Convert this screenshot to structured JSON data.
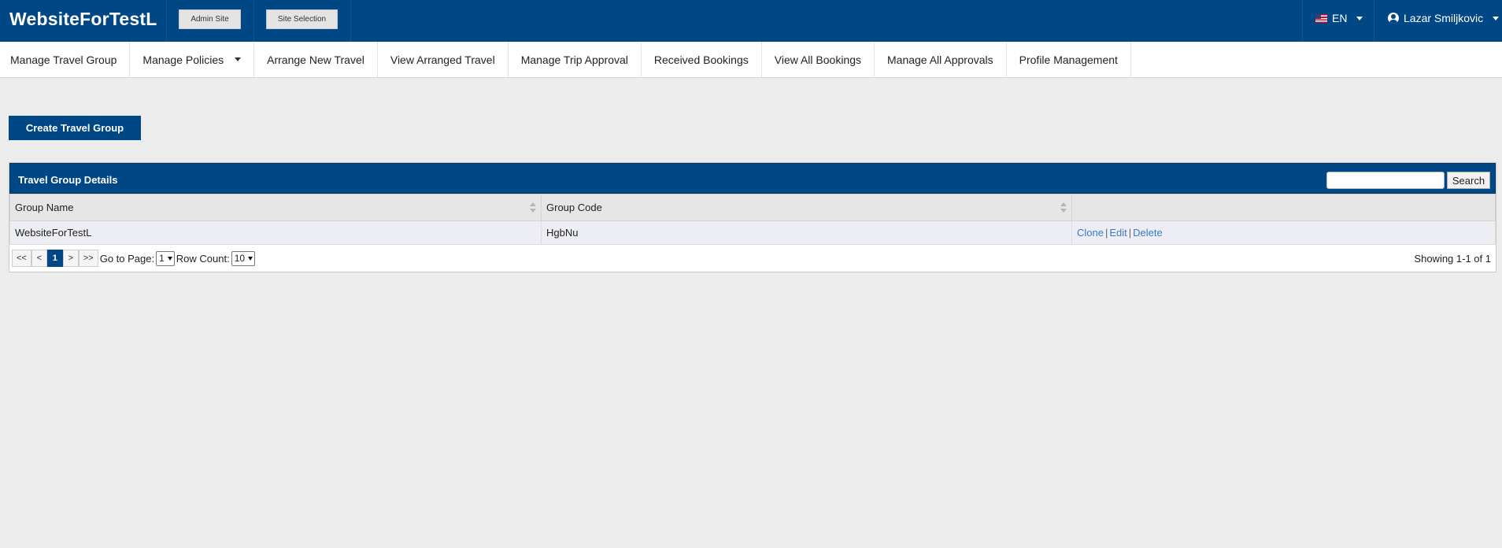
{
  "header": {
    "brand": "WebsiteForTestL",
    "admin_site": "Admin Site",
    "site_selection": "Site Selection",
    "language": "EN",
    "user_name": "Lazar Smiljkovic"
  },
  "nav": {
    "items": [
      {
        "label": "Manage Travel Group"
      },
      {
        "label": "Manage Policies"
      },
      {
        "label": "Arrange New Travel"
      },
      {
        "label": "View Arranged Travel"
      },
      {
        "label": "Manage Trip Approval"
      },
      {
        "label": "Received Bookings"
      },
      {
        "label": "View All Bookings"
      },
      {
        "label": "Manage All Approvals"
      },
      {
        "label": "Profile Management"
      }
    ]
  },
  "main": {
    "create_button": "Create Travel Group"
  },
  "panel": {
    "title": "Travel Group Details",
    "search_button": "Search",
    "search_value": "",
    "columns": [
      "Group Name",
      "Group Code"
    ],
    "rows": [
      {
        "group_name": "WebsiteForTestL",
        "group_code": "HgbNu",
        "actions": [
          "Clone",
          "Edit",
          "Delete"
        ]
      }
    ],
    "pager": {
      "first": "<<",
      "prev": "<",
      "current": "1",
      "next": ">",
      "last": ">>",
      "go_to_label": "Go to Page:",
      "page_value": "1",
      "row_count_label": "Row Count:",
      "row_count_value": "10",
      "showing": "Showing 1-1 of 1"
    }
  },
  "colors": {
    "primary": "#004785",
    "link": "#3a7bc8",
    "background": "#ececec"
  }
}
